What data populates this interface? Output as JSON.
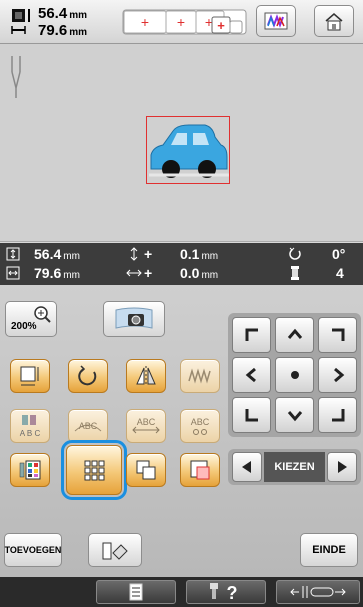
{
  "header": {
    "width_value": "56.4",
    "height_value": "79.6",
    "unit": "mm"
  },
  "info": {
    "height_value": "56.4",
    "width_value": "79.6",
    "offset_y": "0.1",
    "offset_x": "0.0",
    "unit": "mm",
    "rotation": "0°",
    "color_count": "4",
    "offset_y_prefix": "+",
    "offset_x_prefix": "+"
  },
  "panel": {
    "zoom_label": "200%",
    "select_label": "KIEZEN",
    "add_label": "TOEVOEGEN",
    "end_label": "EINDE",
    "abc_label": "ABC",
    "abc_label2": "ABC",
    "abc_label3": "ABC",
    "abc_label4": "A B C"
  },
  "colors": {
    "accent_orange": "#f4c878",
    "selected_outline": "#1a8fe0",
    "design_blue": "#3aa6e0",
    "frame_red": "#e03030"
  }
}
